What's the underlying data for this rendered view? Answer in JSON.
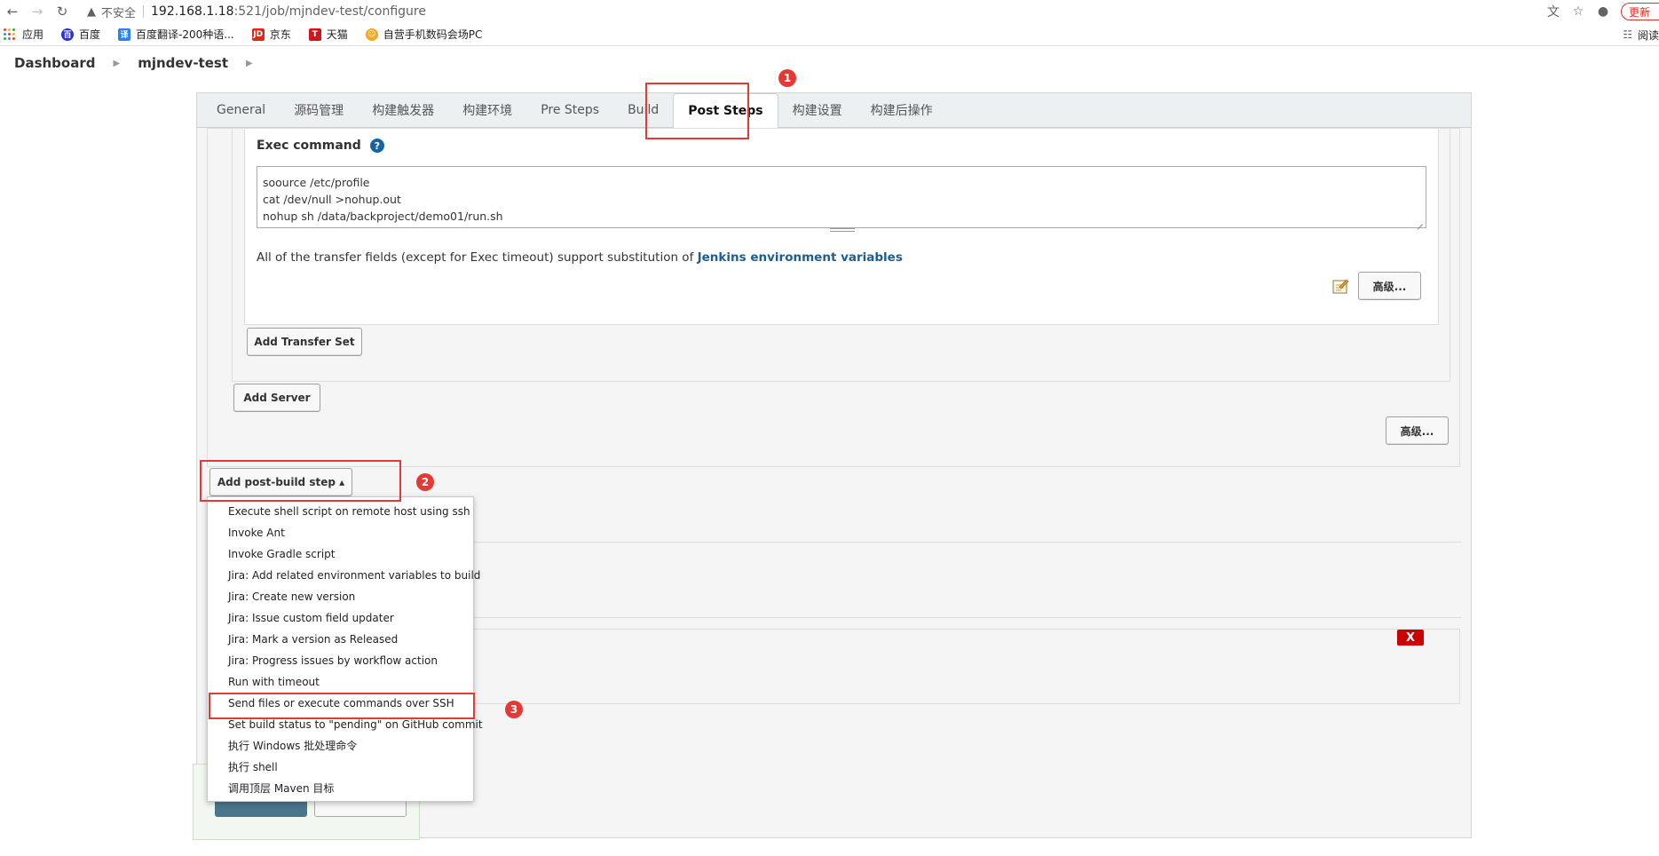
{
  "browser": {
    "security_label": "不安全",
    "url_host": "192.168.1.18",
    "url_rest": ":521/job/mjndev-test/configure",
    "update_label": "更新"
  },
  "bookmarks": {
    "items": [
      {
        "label": "应用"
      },
      {
        "label": "百度"
      },
      {
        "label": "百度翻译-200种语..."
      },
      {
        "label": "京东"
      },
      {
        "label": "天猫"
      },
      {
        "label": "自营手机数码会场PC"
      }
    ],
    "reading_list_label": "阅读"
  },
  "breadcrumb": {
    "dashboard": "Dashboard",
    "job": "mjndev-test"
  },
  "tabs": [
    {
      "label": "General"
    },
    {
      "label": "源码管理"
    },
    {
      "label": "构建触发器"
    },
    {
      "label": "构建环境"
    },
    {
      "label": "Pre Steps"
    },
    {
      "label": "Build"
    },
    {
      "label": "Post Steps"
    },
    {
      "label": "构建设置"
    },
    {
      "label": "构建后操作"
    }
  ],
  "exec": {
    "label": "Exec command",
    "help": "?",
    "lines": [
      "soource /etc/profile",
      "cat /dev/null >nohup.out",
      "nohup sh /data/backproject/demo01/run.sh"
    ]
  },
  "transfer_note": {
    "text": "All of the transfer fields (except for Exec timeout) support substitution of ",
    "link": "Jenkins environment variables"
  },
  "buttons": {
    "advanced": "高级...",
    "add_transfer_set": "Add Transfer Set",
    "add_server": "Add Server",
    "advanced2": "高级...",
    "add_post_build_step": "Add post-build step ▴"
  },
  "markers": [
    "1",
    "2",
    "3"
  ],
  "dropdown": {
    "items": [
      "Execute shell script on remote host using ssh",
      "Invoke Ant",
      "Invoke Gradle script",
      "Jira: Add related environment variables to build",
      "Jira: Create new version",
      "Jira: Issue custom field updater",
      "Jira: Mark a version as Released",
      "Jira: Progress issues by workflow action",
      "Run with timeout",
      "Send files or execute commands over SSH",
      "Set build status to \"pending\" on GitHub commit",
      "执行 Windows 批处理命令",
      "执行 shell",
      "调用顶层 Maven 目标"
    ]
  },
  "delete_label": "X",
  "colors": {
    "highlight": "#e53935",
    "link": "#1f5d8f",
    "delete": "#cc0000"
  }
}
